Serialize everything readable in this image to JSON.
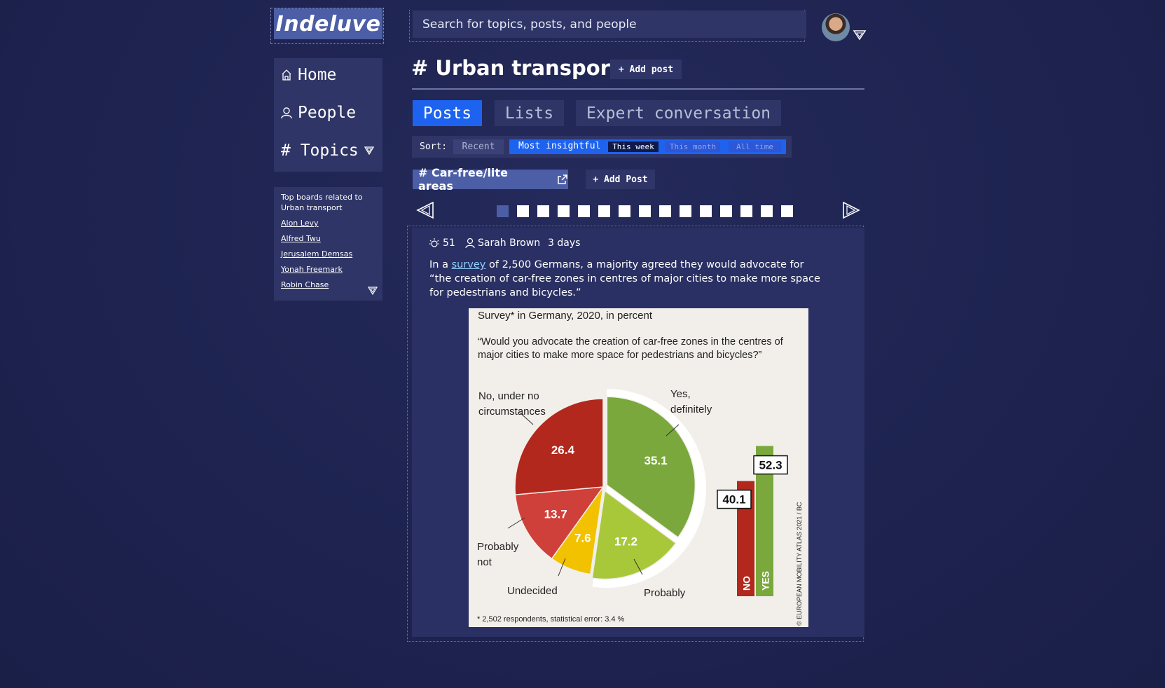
{
  "app": {
    "logo": "Indeluve"
  },
  "search": {
    "placeholder": "Search for topics, posts, and people"
  },
  "sidebar": {
    "nav": [
      {
        "label": "Home",
        "icon": "home-icon"
      },
      {
        "label": "People",
        "icon": "person-icon"
      },
      {
        "label": "# Topics",
        "icon": "chevron-down-icon"
      }
    ],
    "boards_title": "Top boards related to Urban transport",
    "boards": [
      "Alon Levy",
      "Alfred Twu",
      "Jerusalem Demsas",
      "Yonah Freemark",
      "Robin Chase"
    ]
  },
  "header": {
    "title": "# Urban transport",
    "add_post": "+ Add post"
  },
  "tabs": [
    {
      "label": "Posts",
      "active": true
    },
    {
      "label": "Lists",
      "active": false
    },
    {
      "label": "Expert conversation",
      "active": false
    }
  ],
  "sort": {
    "label": "Sort:",
    "recent": "Recent",
    "insightful": "Most insightful",
    "periods": [
      {
        "label": "This week",
        "active": true
      },
      {
        "label": "This month",
        "active": false
      },
      {
        "label": "All time",
        "active": false
      }
    ]
  },
  "board_chip": {
    "label": "# Car-free/lite areas",
    "add_post": "+ Add Post"
  },
  "pager": {
    "current": 1,
    "total": 15
  },
  "post": {
    "insight_count": "51",
    "author": "Sarah Brown",
    "age": "3 days",
    "text_before": "In a ",
    "link_text": "survey",
    "text_after": " of 2,500 Germans, a majority agreed they would advocate for “the creation of car-free zones in centres of major cities to make more space for pedestrians and bicycles.”"
  },
  "figure": {
    "subtitle": "Survey* in Germany, 2020, in percent",
    "question": "“Would you advocate the creation of car-free zones in the centres of major cities to make more space for pedestrians and bicycles?”",
    "footnote": "* 2,502 respondents, statistical error: 3.4 %",
    "credit": "© EUROPEAN MOBILITY ATLAS 2021 / BC",
    "slices": [
      {
        "label": "Yes, definitely",
        "value": 35.1,
        "color": "#7aa83c"
      },
      {
        "label": "Probably",
        "value": 17.2,
        "color": "#a8c83a"
      },
      {
        "label": "Undecided",
        "value": 7.6,
        "color": "#f2c200"
      },
      {
        "label": "Probably not",
        "value": 13.7,
        "color": "#d0403a"
      },
      {
        "label": "No, under no circumstances",
        "value": 26.4,
        "color": "#b2281c"
      }
    ],
    "bars": [
      {
        "label": "NO",
        "value": 40.1,
        "color": "#b2281c"
      },
      {
        "label": "YES",
        "value": 52.3,
        "color": "#7aa83c"
      }
    ]
  },
  "colors": {
    "accent": "#1d63f0",
    "panel": "#2f3566",
    "chip": "#4b5ea6"
  }
}
